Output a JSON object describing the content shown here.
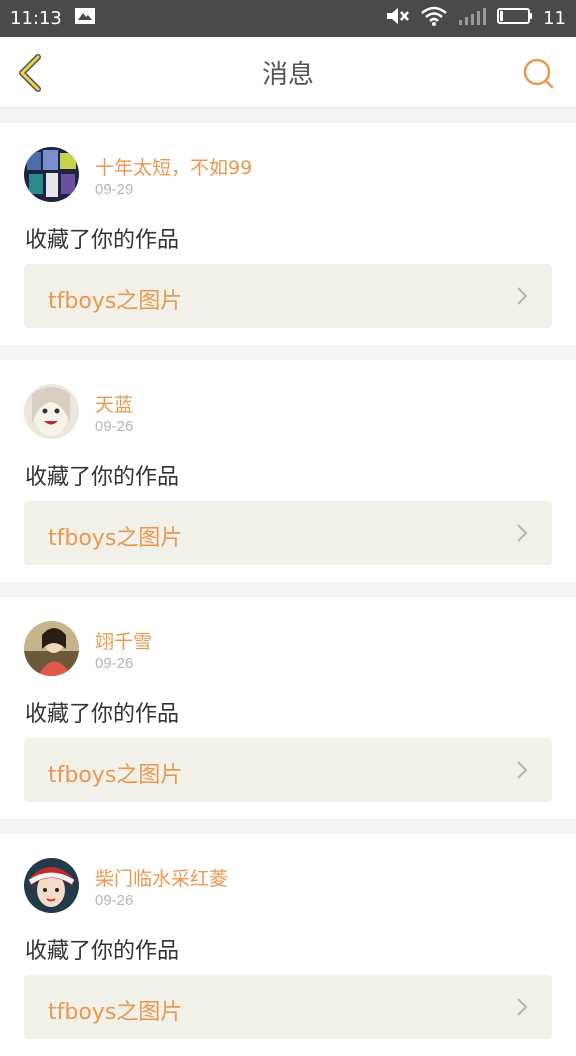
{
  "status_bar": {
    "time": "11:13",
    "battery": "11"
  },
  "header": {
    "title": "消息"
  },
  "messages": [
    {
      "user": "十年太短，不如99",
      "date": "09-29",
      "action": "收藏了你的作品",
      "work": "tfboys之图片"
    },
    {
      "user": "天蓝",
      "date": "09-26",
      "action": "收藏了你的作品",
      "work": "tfboys之图片"
    },
    {
      "user": "翊千雪",
      "date": "09-26",
      "action": "收藏了你的作品",
      "work": "tfboys之图片"
    },
    {
      "user": "柴门临水采红菱",
      "date": "09-26",
      "action": "收藏了你的作品",
      "work": "tfboys之图片"
    }
  ],
  "colors": {
    "accent": "#e8994f",
    "back_icon": "#f2d34c",
    "header_bg": "#ffffff",
    "status_bg": "#4a4a4a"
  }
}
